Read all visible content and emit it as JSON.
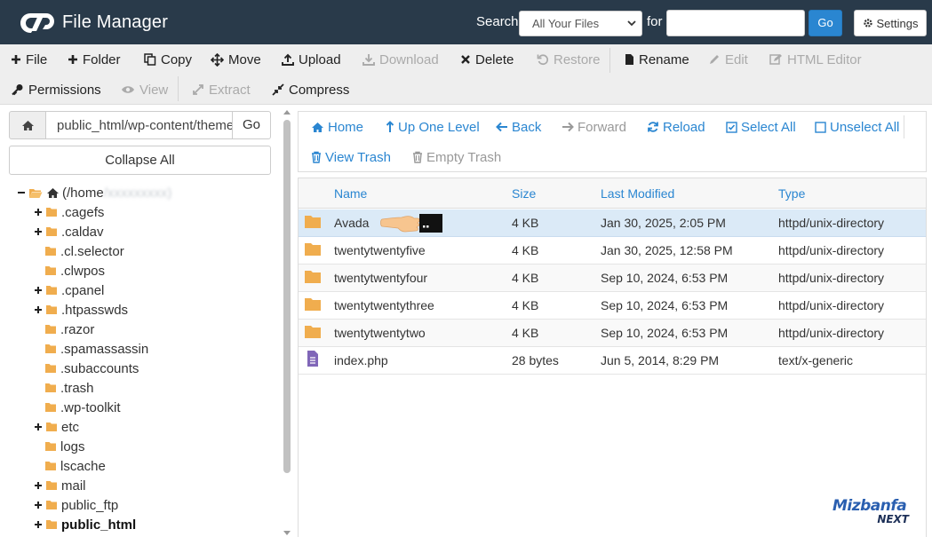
{
  "header": {
    "app_title": "File Manager",
    "search_label": "Search",
    "search_scope": "All Your Files",
    "for_label": "for",
    "search_value": "",
    "go_label": "Go",
    "settings_label": "Settings"
  },
  "toolbar": {
    "file": "File",
    "folder": "Folder",
    "copy": "Copy",
    "move": "Move",
    "upload": "Upload",
    "download": "Download",
    "delete": "Delete",
    "restore": "Restore",
    "rename": "Rename",
    "edit": "Edit",
    "html_editor": "HTML Editor",
    "permissions": "Permissions",
    "view": "View",
    "extract": "Extract",
    "compress": "Compress"
  },
  "left": {
    "path": "public_html/wp-content/themes",
    "go_label": "Go",
    "collapse_all": "Collapse All",
    "root_label": "(/home",
    "root_blurred": "/xxxxxxxxx)",
    "tree": [
      {
        "label": ".cagefs",
        "expand": true,
        "bold": false
      },
      {
        "label": ".caldav",
        "expand": true,
        "bold": false
      },
      {
        "label": ".cl.selector",
        "expand": false,
        "bold": false
      },
      {
        "label": ".clwpos",
        "expand": false,
        "bold": false
      },
      {
        "label": ".cpanel",
        "expand": true,
        "bold": false
      },
      {
        "label": ".htpasswds",
        "expand": true,
        "bold": false
      },
      {
        "label": ".razor",
        "expand": false,
        "bold": false
      },
      {
        "label": ".spamassassin",
        "expand": false,
        "bold": false
      },
      {
        "label": ".subaccounts",
        "expand": false,
        "bold": false
      },
      {
        "label": ".trash",
        "expand": false,
        "bold": false
      },
      {
        "label": ".wp-toolkit",
        "expand": false,
        "bold": false
      },
      {
        "label": "etc",
        "expand": true,
        "bold": false
      },
      {
        "label": "logs",
        "expand": false,
        "bold": false
      },
      {
        "label": "lscache",
        "expand": false,
        "bold": false
      },
      {
        "label": "mail",
        "expand": true,
        "bold": false
      },
      {
        "label": "public_ftp",
        "expand": true,
        "bold": false
      },
      {
        "label": "public_html",
        "expand": true,
        "bold": true
      }
    ]
  },
  "nav": {
    "home": "Home",
    "up_one_level": "Up One Level",
    "back": "Back",
    "forward": "Forward",
    "reload": "Reload",
    "select_all": "Select All",
    "unselect_all": "Unselect All",
    "view_trash": "View Trash",
    "empty_trash": "Empty Trash"
  },
  "table": {
    "columns": [
      "Name",
      "Size",
      "Last Modified",
      "Type"
    ],
    "rows": [
      {
        "name": "Avada",
        "size": "4 KB",
        "modified": "Jan 30, 2025, 2:05 PM",
        "type": "httpd/unix-directory",
        "kind": "folder",
        "selected": true
      },
      {
        "name": "twentytwentyfive",
        "size": "4 KB",
        "modified": "Jan 30, 2025, 12:58 PM",
        "type": "httpd/unix-directory",
        "kind": "folder",
        "selected": false
      },
      {
        "name": "twentytwentyfour",
        "size": "4 KB",
        "modified": "Sep 10, 2024, 6:53 PM",
        "type": "httpd/unix-directory",
        "kind": "folder",
        "selected": false
      },
      {
        "name": "twentytwentythree",
        "size": "4 KB",
        "modified": "Sep 10, 2024, 6:53 PM",
        "type": "httpd/unix-directory",
        "kind": "folder",
        "selected": false
      },
      {
        "name": "twentytwentytwo",
        "size": "4 KB",
        "modified": "Sep 10, 2024, 6:53 PM",
        "type": "httpd/unix-directory",
        "kind": "folder",
        "selected": false
      },
      {
        "name": "index.php",
        "size": "28 bytes",
        "modified": "Jun 5, 2014, 8:29 PM",
        "type": "text/x-generic",
        "kind": "file",
        "selected": false
      }
    ]
  },
  "watermark": {
    "line1": "Mizbanfa",
    "line2": "NEXT"
  },
  "colors": {
    "header_bg": "#293a4a",
    "accent": "#2a86d1",
    "folder": "#f0ad4e",
    "selected_row": "#dbeaf7",
    "file_icon": "#8066b8"
  }
}
